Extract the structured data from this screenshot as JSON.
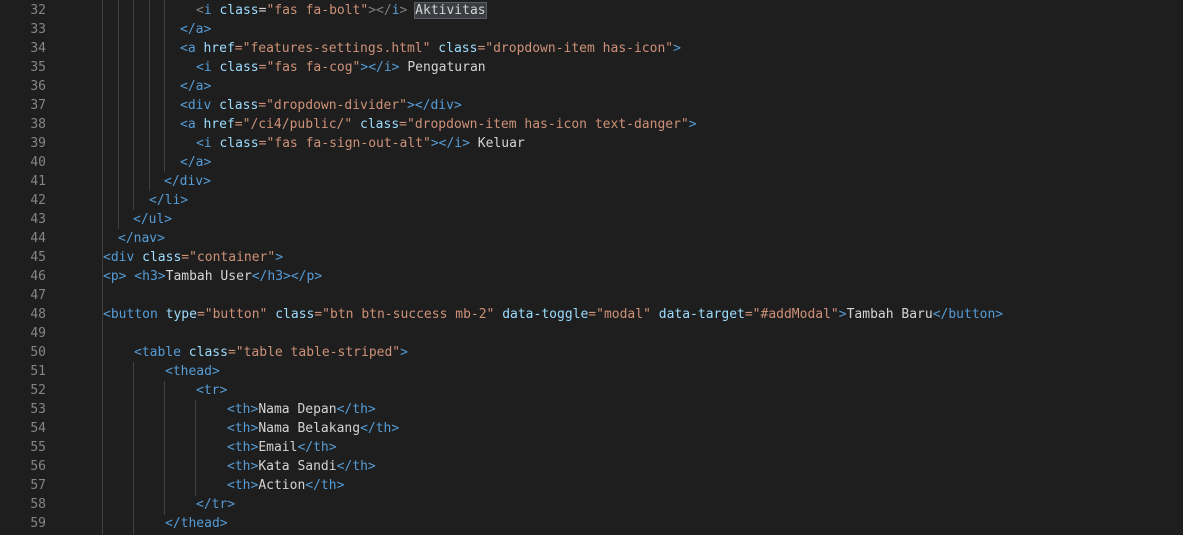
{
  "line_numbers": [
    "32",
    "33",
    "34",
    "35",
    "36",
    "37",
    "38",
    "39",
    "40",
    "41",
    "42",
    "43",
    "44",
    "45",
    "46",
    "47",
    "48",
    "49",
    "50",
    "51",
    "52",
    "53",
    "54",
    "55",
    "56",
    "57",
    "58",
    "59"
  ],
  "code": {
    "l32": {
      "open": "<",
      "tag": "i",
      "sp": " ",
      "a1": "class",
      "eq": "=",
      "s1": "\"fas fa-bolt\"",
      "close": "></",
      "ctag": "i",
      "gt": ">",
      "text": " ",
      "word": "Aktivitas"
    },
    "l33": {
      "text": "</a>"
    },
    "l34": {
      "tag": "<a",
      "a1": " href",
      "s1": "=\"features-settings.html\"",
      "a2": " class",
      "s2": "=\"dropdown-item has-icon\"",
      "end": ">"
    },
    "l35": {
      "tag": "<i",
      "a1": " class",
      "s1": "=\"fas fa-cog\"",
      "end": "></i>",
      "text": " Pengaturan"
    },
    "l36": {
      "text": "</a>"
    },
    "l37": {
      "tag": "<div",
      "a1": " class",
      "s1": "=\"dropdown-divider\"",
      "end": "></div>"
    },
    "l38": {
      "tag": "<a",
      "a1": " href",
      "s1": "=\"/ci4/public/\"",
      "a2": " class",
      "s2": "=\"dropdown-item has-icon text-danger\"",
      "end": ">"
    },
    "l39": {
      "tag": "<i",
      "a1": " class",
      "s1": "=\"fas fa-sign-out-alt\"",
      "end": "></i>",
      "text": " Keluar"
    },
    "l40": {
      "text": "</a>"
    },
    "l41": {
      "text": "</div>"
    },
    "l42": {
      "text": "</li>"
    },
    "l43": {
      "text": "</ul>"
    },
    "l44": {
      "text": "</nav>"
    },
    "l45": {
      "tag": "<div",
      "a1": " class",
      "s1": "=\"container\"",
      "end": ">"
    },
    "l46": {
      "t1": "<p>",
      "t2": " <h3>",
      "text": "Tambah User",
      "t3": "</h3>",
      "t4": "</p>"
    },
    "l48": {
      "tag": "<button",
      "a1": " type",
      "s1": "=\"button\"",
      "a2": " class",
      "s2": "=\"btn btn-success mb-2\"",
      "a3": " data-toggle",
      "s3": "=\"modal\"",
      "a4": " data-target",
      "s4": "=\"#addModal\"",
      "end": ">",
      "text": "Tambah Baru",
      "ctag": "</button>"
    },
    "l50": {
      "tag": "<table",
      "a1": " class",
      "s1": "=\"table table-striped\"",
      "end": ">"
    },
    "l51": {
      "text": "<thead>"
    },
    "l52": {
      "text": "<tr>"
    },
    "l53": {
      "open": "<th>",
      "text": "Nama Depan",
      "close": "</th>"
    },
    "l54": {
      "open": "<th>",
      "text": "Nama Belakang",
      "close": "</th>"
    },
    "l55": {
      "open": "<th>",
      "text": "Email",
      "close": "</th>"
    },
    "l56": {
      "open": "<th>",
      "text": "Kata Sandi",
      "close": "</th>"
    },
    "l57": {
      "open": "<th>",
      "text": "Action",
      "close": "</th>"
    },
    "l58": {
      "text": "</tr>"
    },
    "l59": {
      "text": "</thead>"
    }
  }
}
